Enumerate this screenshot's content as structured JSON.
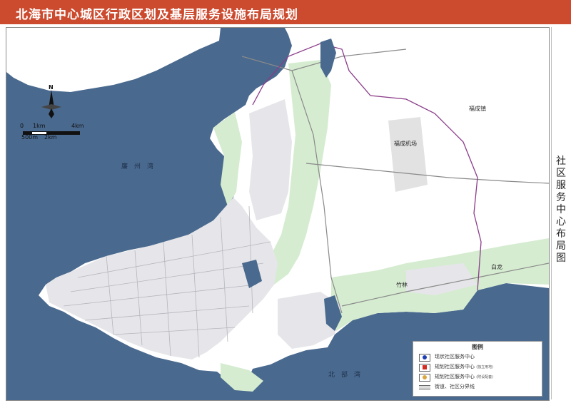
{
  "header": {
    "title": "北海市中心城区行政区划及基层服务设施布局规划"
  },
  "side_panel": {
    "title": "社区服务中心布局图"
  },
  "colors": {
    "title_bar": "#cc4a2e",
    "sea": "#49698e",
    "land": "#ffffff",
    "green": "#d5ecd0",
    "built": "#e6e6ea",
    "boundary": "#8b3c8a"
  },
  "compass": {
    "north_label": "N"
  },
  "scale_bar": {
    "top_labels": [
      "0",
      "1km",
      "4km"
    ],
    "bottom_labels": [
      "500m",
      "2km"
    ]
  },
  "water_labels": {
    "lianzhou_bay": "廉州湾",
    "beibu_gulf": "北部湾"
  },
  "place_labels": {
    "fucheng_town": "福成镇",
    "fucheng_airport": "福成机场",
    "bailong": "白龙",
    "zhulin": "竹林"
  },
  "legend": {
    "title": "图例",
    "items": [
      {
        "label": "现状社区服务中心",
        "note": "",
        "color": "#1e3fb4",
        "shape": "dot"
      },
      {
        "label": "规划社区服务中心",
        "note": "(独立用地)",
        "color": "#d42a1f",
        "shape": "square"
      },
      {
        "label": "规划社区服务中心",
        "note": "(附设配套)",
        "color": "#d9a640",
        "shape": "dot"
      },
      {
        "label": "街道、社区分界线",
        "note": "",
        "color": "#666666",
        "shape": "line"
      }
    ]
  }
}
